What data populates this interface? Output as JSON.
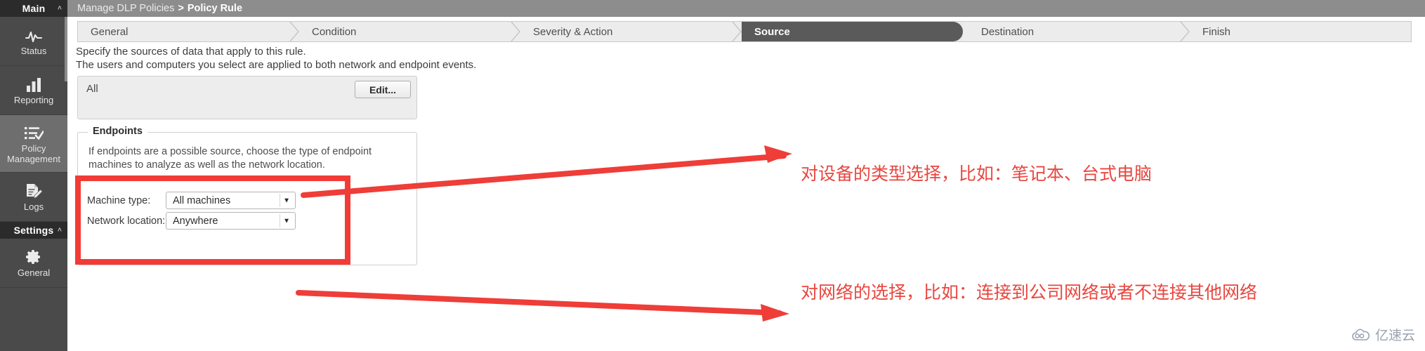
{
  "sidebar": {
    "groups": [
      {
        "name": "Main",
        "label": "Main",
        "chevron": "˄",
        "items": [
          {
            "label": "Status",
            "icon": "pulse-icon",
            "active": false
          },
          {
            "label": "Reporting",
            "icon": "bar-chart-icon",
            "active": false
          },
          {
            "label": "Policy Management",
            "icon": "policy-list-icon",
            "active": true
          },
          {
            "label": "Logs",
            "icon": "log-edit-icon",
            "active": false
          }
        ]
      },
      {
        "name": "Settings",
        "label": "Settings",
        "chevron": "˄",
        "items": [
          {
            "label": "General",
            "icon": "gear-icon",
            "active": false
          }
        ]
      }
    ]
  },
  "breadcrumb": {
    "root": "Manage DLP Policies",
    "separator": ">",
    "current": "Policy Rule"
  },
  "wizard": {
    "steps": [
      {
        "label": "General",
        "active": false
      },
      {
        "label": "Condition",
        "active": false
      },
      {
        "label": "Severity & Action",
        "active": false
      },
      {
        "label": "Source",
        "active": true
      },
      {
        "label": "Destination",
        "active": false
      },
      {
        "label": "Finish",
        "active": false
      }
    ]
  },
  "main": {
    "lead_line1": "Specify the sources of data that apply to this rule.",
    "lead_line2": "The users and computers you select are applied to both network and endpoint events.",
    "source_box": {
      "value": "All",
      "edit_label": "Edit..."
    },
    "endpoints": {
      "legend": "Endpoints",
      "description": "If endpoints are a possible source, choose the type of endpoint machines to analyze as well as the network location.",
      "machine_type": {
        "label": "Machine type:",
        "value": "All machines",
        "caret": "▼"
      },
      "network_location": {
        "label": "Network location:",
        "value": "Anywhere",
        "caret": "▼"
      }
    }
  },
  "annotations": {
    "accent_color": "#e8463f",
    "items": [
      {
        "text": "对设备的类型选择，比如：笔记本、台式电脑"
      },
      {
        "text": "对网络的选择，比如：连接到公司网络或者不连接其他网络"
      }
    ]
  },
  "watermark": {
    "text": "亿速云"
  }
}
